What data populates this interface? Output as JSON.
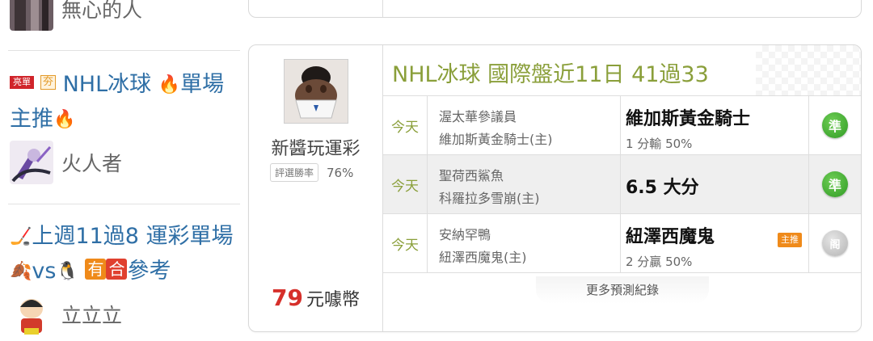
{
  "sidebar": {
    "top_user": {
      "name": "無心的人"
    },
    "post2": {
      "badge_hot": "亮單",
      "badge_win": "夯",
      "title_a": "NHL冰球 ",
      "title_b": "單場主推",
      "emoji_fire": "🔥",
      "user": "火人者"
    },
    "post3": {
      "emoji_stick": "🏒",
      "title_a": "上週11過8 運彩單場 ",
      "emoji_leaf": "🍂",
      "vs": "vs",
      "emoji_penguin": "🐧",
      "box1": "有",
      "box2": "合",
      "title_b": "參考",
      "user": "立立立"
    }
  },
  "card": {
    "author": "新醬玩運彩",
    "winrate_label": "評選勝率",
    "winrate_value": "76%",
    "price_number": "79",
    "price_unit": "元噱幣",
    "record_title": "NHL冰球 國際盤近11日 41過33",
    "rows": [
      {
        "day": "今天",
        "away": "渥太華參議員",
        "home": "維加斯黃金騎士(主)",
        "pick": "維加斯黃金騎士",
        "sub": "1 分輸 50%",
        "tag": "",
        "result": "準",
        "result_state": "win"
      },
      {
        "day": "今天",
        "away": "聖荷西鯊魚",
        "home": "科羅拉多雪崩(主)",
        "pick": "6.5 大分",
        "sub": "",
        "tag": "",
        "result": "準",
        "result_state": "win"
      },
      {
        "day": "今天",
        "away": "安納罕鴨",
        "home": "紐澤西魔鬼(主)",
        "pick": "紐澤西魔鬼",
        "sub": "2 分贏 50%",
        "tag": "主推",
        "result": "阁",
        "result_state": "pending"
      }
    ],
    "more_label": "更多預測紀錄"
  },
  "colors": {
    "link_blue": "#2f6fa6",
    "title_green": "#8a9f3a",
    "price_red": "#d6302b",
    "win_green": "#3aa82c",
    "tag_orange": "#ef8a1a"
  }
}
